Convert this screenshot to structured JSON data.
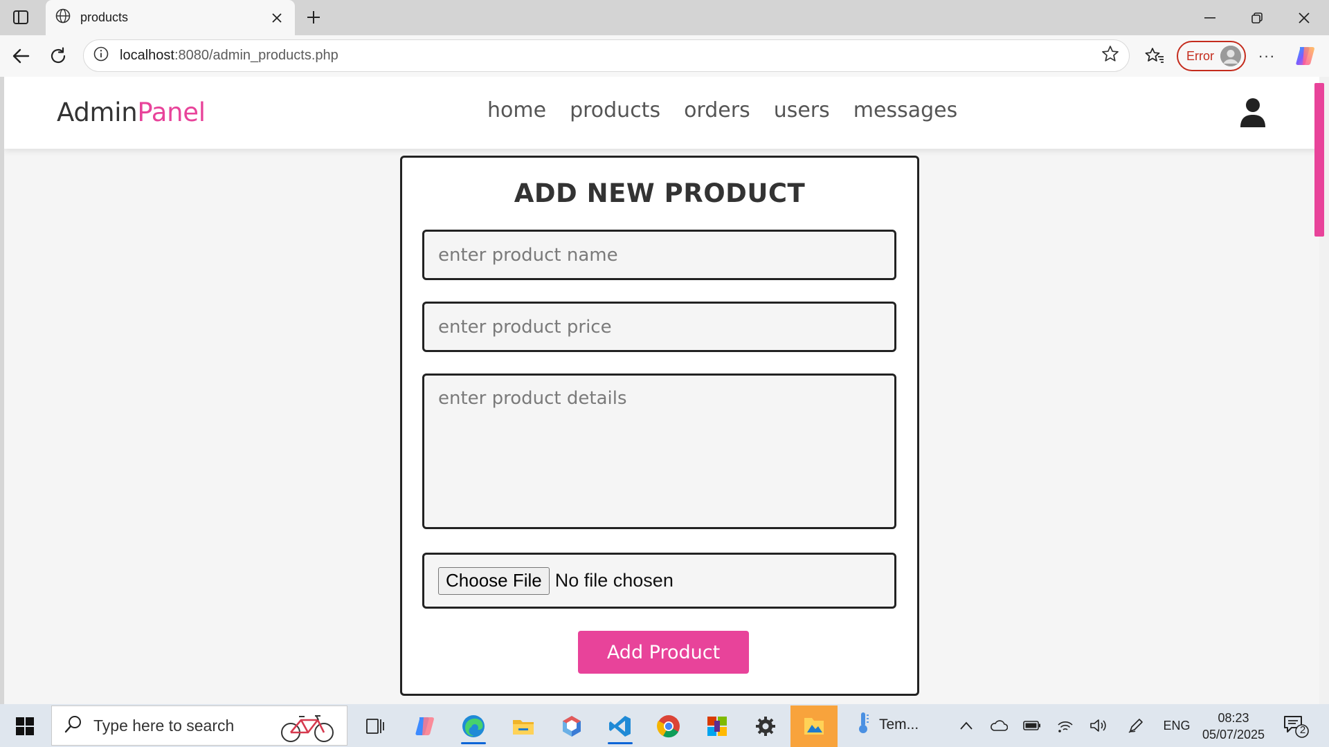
{
  "browser": {
    "tab_title": "products",
    "url_host": "localhost",
    "url_path": ":8080/admin_products.php",
    "profile_status": "Error",
    "more_label": "···"
  },
  "site": {
    "logo_main": "Admin",
    "logo_accent": "Panel",
    "nav": [
      "home",
      "products",
      "orders",
      "users",
      "messages"
    ],
    "accent_color": "#e8439a"
  },
  "form": {
    "title": "ADD NEW PRODUCT",
    "name_placeholder": "enter product name",
    "price_placeholder": "enter product price",
    "details_placeholder": "enter product details",
    "file_button": "Choose File",
    "file_status": "No file chosen",
    "submit_label": "Add Product"
  },
  "taskbar": {
    "search_placeholder": "Type here to search",
    "weather_text": "Tem...",
    "language": "ENG",
    "time": "08:23",
    "date": "05/07/2025",
    "notification_count": "2"
  }
}
